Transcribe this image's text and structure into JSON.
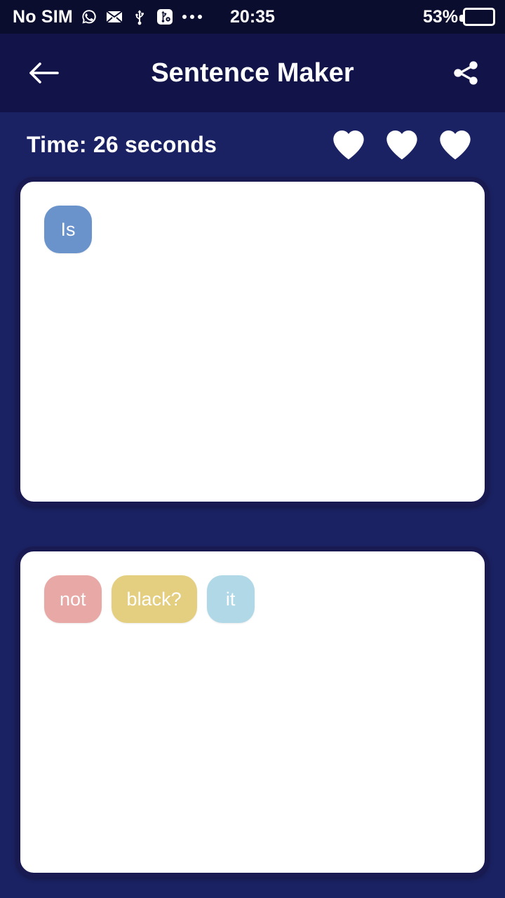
{
  "status_bar": {
    "carrier": "No SIM",
    "icons": [
      "whatsapp-icon",
      "mail-icon",
      "usb-icon",
      "usb-debug-icon",
      "more-dots-icon"
    ],
    "clock": "20:35",
    "battery_percent": "53%",
    "battery_state": "charging"
  },
  "app_bar": {
    "back_icon": "arrow-back-icon",
    "title": "Sentence Maker",
    "share_icon": "share-icon"
  },
  "game_info": {
    "timer_label": "Time: 26 seconds",
    "lives_count": 3,
    "heart_icon": "heart-icon"
  },
  "answer_card": {
    "chips": [
      {
        "label": "Is",
        "color": "#6b93cb"
      }
    ]
  },
  "word_bank_card": {
    "chips": [
      {
        "label": "not",
        "color": "#e7a8a6"
      },
      {
        "label": "black?",
        "color": "#e4ce7f"
      },
      {
        "label": "it",
        "color": "#b0d8e7"
      }
    ]
  },
  "theme": {
    "page_background": "#1b2263",
    "app_bar_background": "#121349",
    "status_bar_background": "#0b0d2e",
    "card_border": "#1a1a52",
    "card_background": "#ffffff",
    "text_on_dark": "#ffffff"
  }
}
